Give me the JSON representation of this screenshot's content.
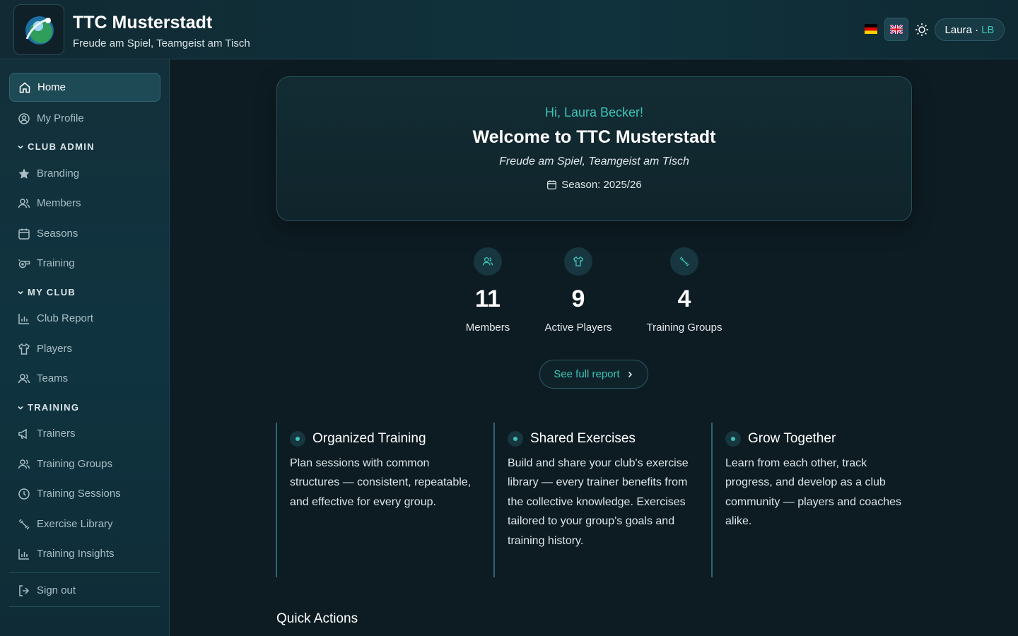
{
  "header": {
    "title": "TTC Musterstadt",
    "subtitle": "Freude am Spiel, Teamgeist am Tisch",
    "user_name": "Laura ·",
    "user_initials": "LB"
  },
  "sidebar": {
    "items_top": [
      {
        "label": "Home",
        "icon": "home-icon",
        "active": true
      },
      {
        "label": "My Profile",
        "icon": "profile-icon"
      }
    ],
    "sections": [
      {
        "title": "CLUB ADMIN",
        "items": [
          {
            "label": "Branding",
            "icon": "star-icon"
          },
          {
            "label": "Members",
            "icon": "users-icon"
          },
          {
            "label": "Seasons",
            "icon": "calendar-icon"
          },
          {
            "label": "Training",
            "icon": "whistle-icon"
          }
        ]
      },
      {
        "title": "MY CLUB",
        "items": [
          {
            "label": "Club Report",
            "icon": "chart-icon"
          },
          {
            "label": "Players",
            "icon": "shirt-icon"
          },
          {
            "label": "Teams",
            "icon": "users-icon"
          }
        ]
      },
      {
        "title": "TRAINING",
        "items": [
          {
            "label": "Trainers",
            "icon": "megaphone-icon"
          },
          {
            "label": "Training Groups",
            "icon": "users-icon"
          },
          {
            "label": "Training Sessions",
            "icon": "clock-icon"
          },
          {
            "label": "Exercise Library",
            "icon": "dumbbell-icon"
          },
          {
            "label": "Training Insights",
            "icon": "chart-icon"
          }
        ]
      }
    ],
    "sign_out": "Sign out"
  },
  "hero": {
    "greeting": "Hi, Laura Becker!",
    "title": "Welcome to TTC Musterstadt",
    "tagline": "Freude am Spiel, Teamgeist am Tisch",
    "season": "Season: 2025/26"
  },
  "stats": [
    {
      "value": "11",
      "label": "Members",
      "icon": "users-icon"
    },
    {
      "value": "9",
      "label": "Active Players",
      "icon": "shirt-icon"
    },
    {
      "value": "4",
      "label": "Training Groups",
      "icon": "dumbbell-icon"
    }
  ],
  "report_button": "See full report",
  "features": [
    {
      "title": "Organized Training",
      "text": "Plan sessions with common structures — consistent, repeatable, and effective for every group."
    },
    {
      "title": "Shared Exercises",
      "text": "Build and share your club's exercise library — every trainer benefits from the collective knowledge. Exercises tailored to your group's goals and training history."
    },
    {
      "title": "Grow Together",
      "text": "Learn from each other, track progress, and develop as a club community — players and coaches alike."
    }
  ],
  "quick_actions": "Quick Actions",
  "colors": {
    "accent": "#3cc4b8",
    "background": "#0d1c23",
    "sidebar": "#0f3440"
  }
}
